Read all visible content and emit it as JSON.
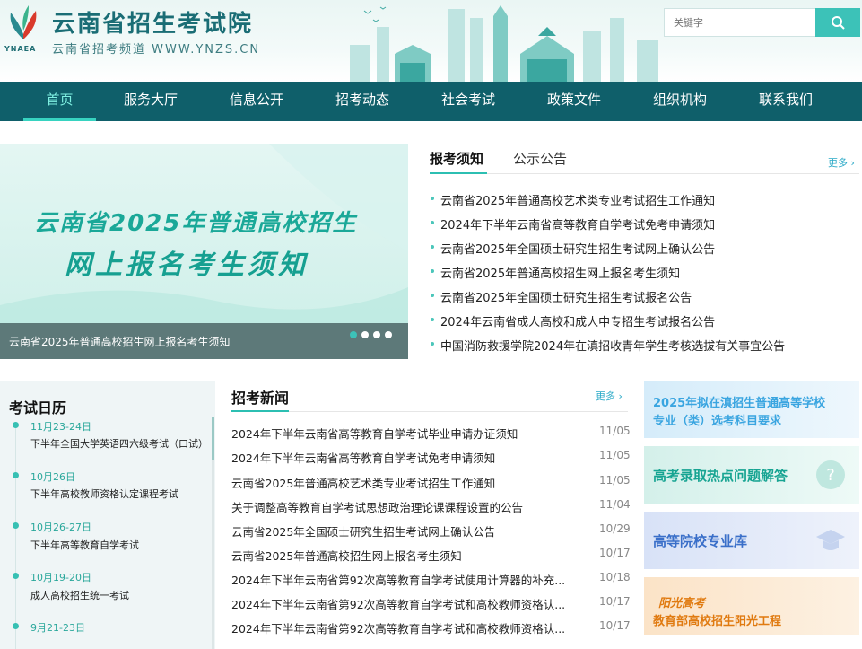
{
  "header": {
    "title": "云南省招生考试院",
    "subtitle": "云南省招考频道 WWW.YNZS.CN",
    "logo_abbr": "YNAEA"
  },
  "search": {
    "placeholder": "关键字",
    "icon": "search-icon"
  },
  "nav": {
    "items": [
      "首页",
      "服务大厅",
      "信息公开",
      "招考动态",
      "社会考试",
      "政策文件",
      "组织机构",
      "联系我们"
    ],
    "active": "首页"
  },
  "banner": {
    "line1": "云南省2025年普通高校招生",
    "line2": "网上报名考生须知",
    "caption": "云南省2025年普通高校招生网上报名考生须知"
  },
  "notice": {
    "tab_active": "报考须知",
    "tab_other": "公示公告",
    "more": "更多",
    "items": [
      "云南省2025年普通高校艺术类专业考试招生工作通知",
      "2024年下半年云南省高等教育自学考试免考申请须知",
      "云南省2025年全国硕士研究生招生考试网上确认公告",
      "云南省2025年普通高校招生网上报名考生须知",
      "云南省2025年全国硕士研究生招生考试报名公告",
      "2024年云南省成人高校和成人中专招生考试报名公告",
      "中国消防救援学院2024年在滇招收青年学生考核选拔有关事宜公告"
    ]
  },
  "calendar": {
    "title": "考试日历",
    "entries": [
      {
        "date": "11月23-24日",
        "event": "下半年全国大学英语四六级考试（口试）"
      },
      {
        "date": "10月26日",
        "event": "下半年高校教师资格认定课程考试"
      },
      {
        "date": "10月26-27日",
        "event": "下半年高等教育自学考试"
      },
      {
        "date": "10月19-20日",
        "event": "成人高校招生统一考试"
      },
      {
        "date": "9月21-23日",
        "event": ""
      }
    ]
  },
  "news": {
    "title": "招考新闻",
    "more": "更多",
    "items": [
      {
        "title": "2024年下半年云南省高等教育自学考试毕业申请办证须知",
        "date": "11/05"
      },
      {
        "title": "2024年下半年云南省高等教育自学考试免考申请须知",
        "date": "11/05"
      },
      {
        "title": "云南省2025年普通高校艺术类专业考试招生工作通知",
        "date": "11/05"
      },
      {
        "title": "关于调整高等教育自学考试思想政治理论课课程设置的公告",
        "date": "11/04"
      },
      {
        "title": "云南省2025年全国硕士研究生招生考试网上确认公告",
        "date": "10/29"
      },
      {
        "title": "云南省2025年普通高校招生网上报名考生须知",
        "date": "10/17"
      },
      {
        "title": "2024年下半年云南省第92次高等教育自学考试使用计算器的补充...",
        "date": "10/18"
      },
      {
        "title": "2024年下半年云南省第92次高等教育自学考试和高校教师资格认...",
        "date": "10/17"
      },
      {
        "title": "2024年下半年云南省第92次高等教育自学考试和高校教师资格认...",
        "date": "10/17"
      }
    ]
  },
  "cards": [
    {
      "line1": "2025年拟在滇招生普通高等学校",
      "line2": "专业（类）选考科目要求",
      "color": "#3aa5e0",
      "bg": "#dff0fb"
    },
    {
      "line1": "高考录取热点问题解答",
      "line2": "",
      "color": "#17a492",
      "bg": "#ddf3ee"
    },
    {
      "line1": "高等院校专业库",
      "line2": "",
      "color": "#3a6fc9",
      "bg": "#e1e9f8"
    },
    {
      "line1": "阳光高考",
      "line2": "教育部高校招生阳光工程",
      "color": "#e07a10",
      "bg": "#fbe9d2"
    }
  ],
  "colors": {
    "nav_bg": "#0f5f6a",
    "accent": "#2cbfb2",
    "title": "#1a6d75"
  }
}
